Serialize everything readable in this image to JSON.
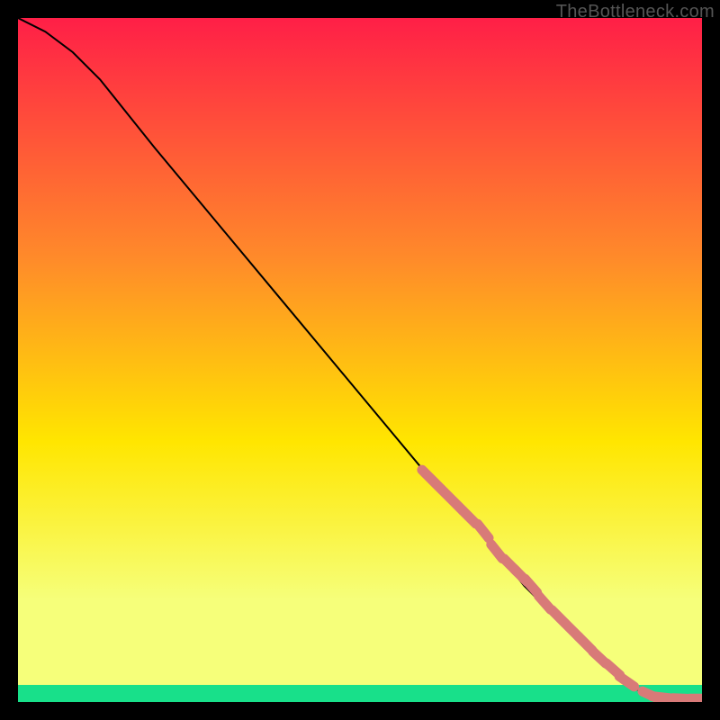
{
  "watermark": "TheBottleneck.com",
  "colors": {
    "grad_top": "#ff1f47",
    "grad_mid1": "#ff8a2a",
    "grad_mid2": "#ffe600",
    "grad_mid3": "#f6ff7a",
    "grad_bottom_band": "#18e08a",
    "curve": "#000000",
    "marker_fill": "#d87a78",
    "marker_stroke": "#c46260",
    "frame": "#000000"
  },
  "chart_data": {
    "type": "line",
    "title": "",
    "xlabel": "",
    "ylabel": "",
    "xlim": [
      0,
      100
    ],
    "ylim": [
      0,
      100
    ],
    "series": [
      {
        "name": "bottleneck-curve",
        "x": [
          0,
          4,
          8,
          12,
          20,
          30,
          40,
          50,
          60,
          66,
          70,
          74,
          78,
          82,
          86,
          90,
          92,
          95,
          97,
          100
        ],
        "y": [
          100,
          98,
          95,
          91,
          81,
          69,
          57,
          45,
          33,
          27,
          22,
          17,
          13,
          9,
          5,
          2,
          1.2,
          0.6,
          0.5,
          0.5
        ]
      }
    ],
    "markers": {
      "name": "highlighted-segment",
      "x": [
        60,
        62,
        64,
        66,
        68,
        70,
        72,
        73.5,
        75,
        77,
        79,
        81,
        83,
        85,
        87,
        89,
        92.5,
        94,
        97,
        99.5
      ],
      "y": [
        33,
        31,
        29,
        27,
        25,
        22,
        20,
        18.5,
        17,
        14.5,
        12.5,
        10.5,
        8.5,
        6.5,
        4.8,
        3.0,
        1.0,
        0.7,
        0.5,
        0.5
      ]
    },
    "green_band": {
      "y_from": 0,
      "y_to": 2.5
    }
  }
}
